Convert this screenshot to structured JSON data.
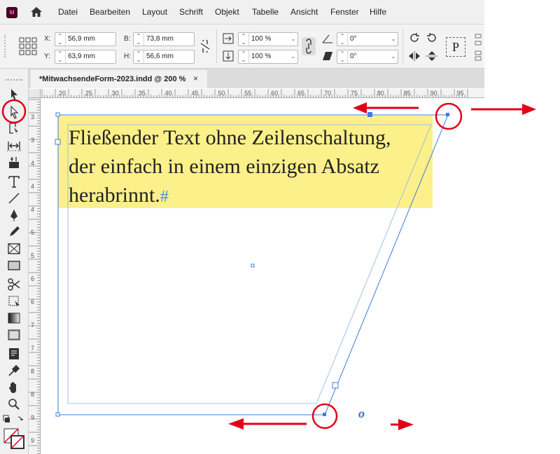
{
  "app": {
    "logo_text": "Id"
  },
  "menu": {
    "items": [
      "Datei",
      "Bearbeiten",
      "Layout",
      "Schrift",
      "Objekt",
      "Tabelle",
      "Ansicht",
      "Fenster",
      "Hilfe"
    ]
  },
  "control": {
    "x_label": "X:",
    "x_value": "56,9 mm",
    "y_label": "Y:",
    "y_value": "63,9 mm",
    "w_label": "B:",
    "w_value": "73,8 mm",
    "h_label": "H:",
    "h_value": "56,6 mm",
    "scale_x_value": "100 %",
    "scale_y_value": "100 %",
    "rotate_value": "0°",
    "shear_value": "0°"
  },
  "tab": {
    "title": "*MitwachsendeForm-2023.indd @ 200 %",
    "close": "×"
  },
  "ruler_top": [
    "20",
    "25",
    "30",
    "35",
    "40",
    "45",
    "50",
    "55",
    "60",
    "65",
    "70",
    "75",
    "80",
    "85",
    "90",
    "95"
  ],
  "ruler_left": [
    "3",
    "3",
    "4",
    "4",
    "4",
    "5",
    "5",
    "6",
    "6",
    "7",
    "7",
    "8",
    "8",
    "9",
    "9"
  ],
  "story": {
    "lines": [
      "Fließender Text ohne Zeilenschaltung,",
      "der einfach in einem einzigen Absatz",
      "herabrinnt."
    ],
    "pilcrow": "#"
  },
  "annotation": {
    "o_label": "o"
  },
  "colors": {
    "highlight": "#fbf08a",
    "frame": "#3c7dd9",
    "annotation_red": "#e3001b"
  }
}
